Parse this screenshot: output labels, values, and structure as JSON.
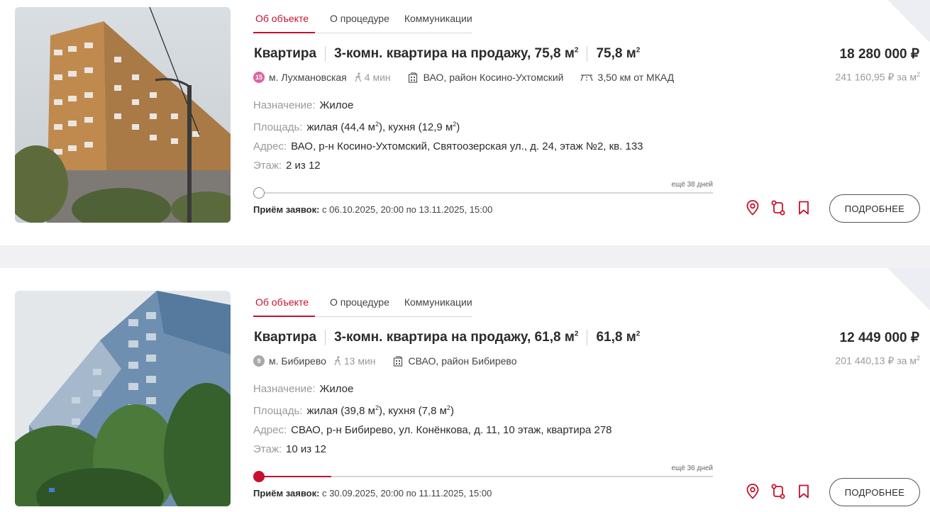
{
  "accent_color": "#c8102e",
  "listings": [
    {
      "tabs": [
        "Об объекте",
        "О процедуре",
        "Коммуникации"
      ],
      "type": "Квартира",
      "headline": "3-комн. квартира на продажу, 75,8 м",
      "area": "75,8  м",
      "price": "18 280 000 ₽",
      "price_per_m2": "241 160,95 ₽ за м",
      "metro_line": "15",
      "metro_color": "#de64a1",
      "metro": "м. Лухмановская",
      "walk": "4 мин",
      "district": "ВАО, район Косино-Ухтомский",
      "mkad": "3,50 км от МКАД",
      "purpose_label": "Назначение:",
      "purpose": "Жилое",
      "area_label": "Площадь:",
      "area_living": "жилая (44,4 м",
      "area_kitchen": "), кухня (12,9 м",
      "area_end": ")",
      "address_label": "Адрес:",
      "address": "ВАО, р-н Косино-Ухтомский, Святоозерская ул., д. 24, этаж №2, кв. 133",
      "floor_label": "Этаж:",
      "floor": "2 из 12",
      "days_left": "ещё 38 дней",
      "progress": 0.0,
      "apply_label": "Приём заявок:",
      "apply_period": " с 06.10.2025, 20:00 по 13.11.2025, 15:00",
      "more_label": "ПОДРОБНЕЕ",
      "icons": [
        "map-pin-icon",
        "route-icon",
        "bookmark-icon"
      ]
    },
    {
      "tabs": [
        "Об объекте",
        "О процедуре",
        "Коммуникации"
      ],
      "type": "Квартира",
      "headline": "3-комн. квартира на продажу, 61,8 м",
      "area": "61,8  м",
      "price": "12 449 000 ₽",
      "price_per_m2": "201 440,13 ₽ за м",
      "metro_line": "9",
      "metro_color": "#a7a9ab",
      "metro": "м. Бибирево",
      "walk": "13 мин",
      "district": "СВАО, район Бибирево",
      "mkad": "",
      "purpose_label": "Назначение:",
      "purpose": "Жилое",
      "area_label": "Площадь:",
      "area_living": "жилая (39,8 м",
      "area_kitchen": "), кухня (7,8 м",
      "area_end": ")",
      "address_label": "Адрес:",
      "address": "СВАО, р-н Бибирево, ул. Конёнкова, д. 11, 10 этаж, квартира 278",
      "floor_label": "Этаж:",
      "floor": "10 из 12",
      "days_left": "ещё 36 дней",
      "progress": 0.16,
      "apply_label": "Приём заявок:",
      "apply_period": " с 30.09.2025, 20:00 по 11.11.2025, 15:00",
      "more_label": "ПОДРОБНЕЕ",
      "icons": [
        "map-pin-icon",
        "route-icon",
        "bookmark-icon"
      ]
    }
  ]
}
